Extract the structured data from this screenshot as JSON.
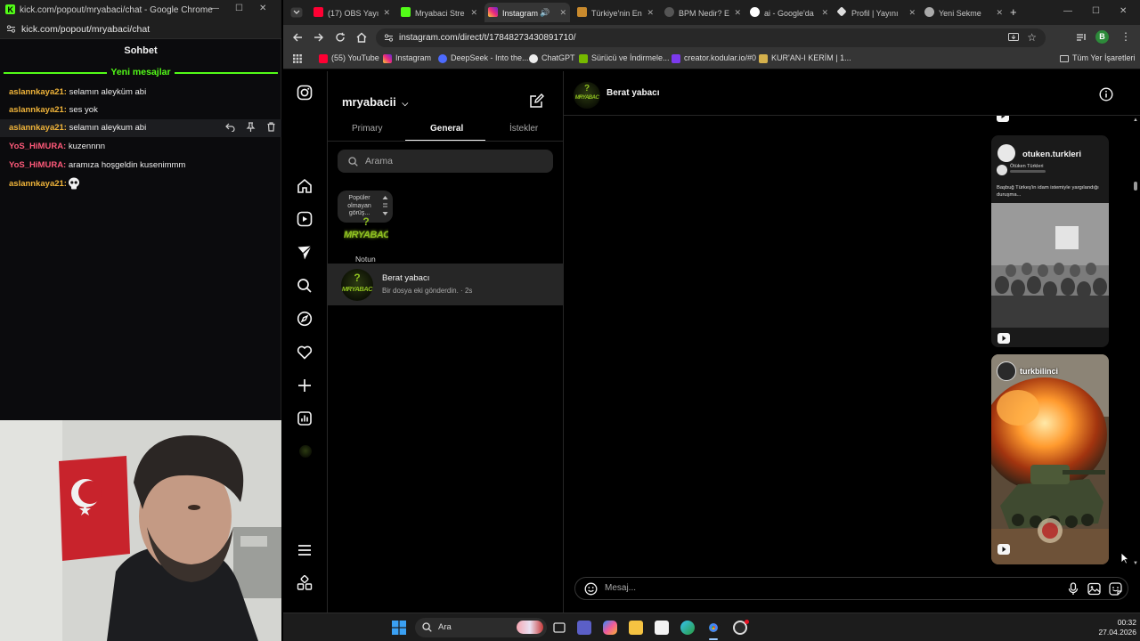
{
  "left_window": {
    "title": "kick.com/popout/mryabaci/chat - Google Chrome",
    "url": "kick.com/popout/mryabaci/chat",
    "chat_header": "Sohbet",
    "new_messages_label": "Yeni mesajlar",
    "messages": [
      {
        "user": "aslannkaya21:",
        "text": " selamın aleyküm abi",
        "color": "#f0b43a"
      },
      {
        "user": "aslannkaya21:",
        "text": " ses yok",
        "color": "#f0b43a"
      },
      {
        "user": "aslannkaya21:",
        "text": " selamın aleykum abi",
        "color": "#f0b43a"
      },
      {
        "user": "YoS_HiMURA:",
        "text": " kuzennnn",
        "color": "#ff5a7a"
      },
      {
        "user": "YoS_HiMURA:",
        "text": " aramıza hoşgeldin kusenimmm",
        "color": "#ff5a7a"
      },
      {
        "user": "aslannkaya21:",
        "text": "",
        "color": "#f0b43a"
      }
    ]
  },
  "browser": {
    "tabs": [
      {
        "label": "(17) OBS Yayı",
        "icon": "youtube-icon",
        "color": "#ff0033"
      },
      {
        "label": "Mryabaci Stre",
        "icon": "kick-icon",
        "color": "#53fc18"
      },
      {
        "label": "Instagram",
        "icon": "instagram-icon",
        "color": "#e1306c"
      },
      {
        "label": "Türkiye'nin En",
        "icon": "site-icon",
        "color": "#c98a2d"
      },
      {
        "label": "BPM Nedir? E",
        "icon": "site-icon",
        "color": "#888888"
      },
      {
        "label": "ai - Google'da",
        "icon": "google-icon",
        "color": "#4285f4"
      },
      {
        "label": "Profil | Yayını",
        "icon": "site-icon",
        "color": "#dddddd"
      },
      {
        "label": "Yeni Sekme",
        "icon": "chrome-icon",
        "color": "#aaaaaa"
      }
    ],
    "url": "instagram.com/direct/t/17848273430891710/",
    "bookmarks": [
      {
        "label": "(55) YouTube",
        "color": "#ff0033"
      },
      {
        "label": "Instagram",
        "color": "#e1306c"
      },
      {
        "label": "DeepSeek - Into the...",
        "color": "#4d6bfe"
      },
      {
        "label": "ChatGPT",
        "color": "#eeeeee"
      },
      {
        "label": "Sürücü ve İndirmele...",
        "color": "#76b900"
      },
      {
        "label": "creator.kodular.io/#0",
        "color": "#7c3aed"
      },
      {
        "label": "KUR'AN-I KERİM | 1...",
        "color": "#d4b04c"
      }
    ],
    "all_bookmarks": "Tüm Yer İşaretleri",
    "profile_initial": "B"
  },
  "instagram": {
    "account": "mryabacii",
    "tabs": [
      "Primary",
      "General",
      "İstekler"
    ],
    "search_placeholder": "Arama",
    "note_bubble": "Popüler olmayan görüş...",
    "note_label": "Notun",
    "logo_text": "MRYABAC",
    "thread": {
      "name": "Berat yabacı",
      "preview": "Bir dosya eki gönderdin. · 2s"
    },
    "chat_title": "Berat yabacı",
    "card1": {
      "account": "otuken.turkleri",
      "sub": "Ötüken Türkleri",
      "caption": "Başbuğ Türkeş'in idam istemiyle yargılandığı duruşma..."
    },
    "card2": {
      "account": "turkbilinci"
    },
    "message_placeholder": "Mesaj..."
  },
  "taskbar": {
    "search_label": "Ara",
    "time": "00:32",
    "date": "27.04.2026"
  }
}
